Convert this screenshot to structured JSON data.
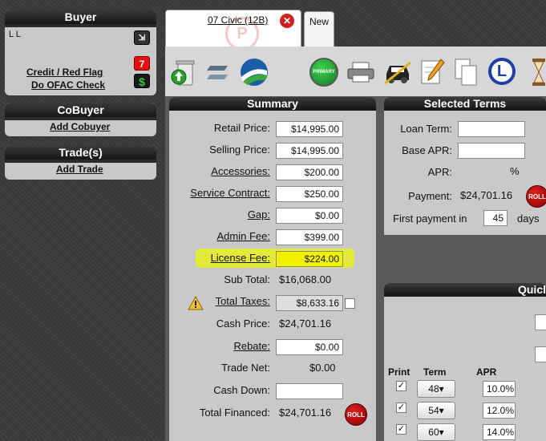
{
  "buyer": {
    "title": "Buyer",
    "name": "L L",
    "credit_link": "Credit / Red Flag",
    "ofac_link": "Do OFAC Check",
    "badge_count": "7",
    "dollar_icon": "$"
  },
  "cobuyer": {
    "title": "CoBuyer",
    "add_link": "Add Cobuyer"
  },
  "trades": {
    "title": "Trade(s)",
    "add_link": "Add Trade"
  },
  "tabs": [
    {
      "label": "07 Civic (12B)"
    },
    {
      "label": "New"
    }
  ],
  "toolbar": {
    "primary_label": "PRIMARY",
    "l_label": "L"
  },
  "summary": {
    "title": "Summary",
    "retail_price_label": "Retail Price:",
    "retail_price": "$14,995.00",
    "selling_price_label": "Selling Price:",
    "selling_price": "$14,995.00",
    "accessories_label": "Accessories:",
    "accessories": "$200.00",
    "service_contract_label": "Service Contract:",
    "service_contract": "$250.00",
    "gap_label": "Gap:",
    "gap": "$0.00",
    "admin_fee_label": "Admin Fee:",
    "admin_fee": "$399.00",
    "license_fee_label": "License Fee:",
    "license_fee": "$224.00",
    "sub_total_label": "Sub Total:",
    "sub_total": "$16,068.00",
    "total_taxes_label": "Total Taxes:",
    "total_taxes": "$8,633.16",
    "cash_price_label": "Cash Price:",
    "cash_price": "$24,701.16",
    "rebate_label": "Rebate:",
    "rebate": "$0.00",
    "trade_net_label": "Trade Net:",
    "trade_net": "$0.00",
    "cash_down_label": "Cash Down:",
    "cash_down": "",
    "total_financed_label": "Total Financed:",
    "total_financed": "$24,701.16",
    "roll_label": "ROLL"
  },
  "selected_terms": {
    "title": "Selected Terms",
    "loan_term_label": "Loan Term:",
    "loan_term": "",
    "base_apr_label": "Base APR:",
    "base_apr": "",
    "apr_label": "APR:",
    "apr_unit": "%",
    "payment_label": "Payment:",
    "payment": "$24,701.16",
    "roll_label": "ROLL",
    "first_payment_label": "First payment in",
    "first_payment_days": "45",
    "days_label": "days"
  },
  "quick": {
    "title": "Quicl",
    "col_print": "Print",
    "col_term": "Term",
    "col_apr": "APR",
    "rows": [
      {
        "term": "48",
        "apr": "10.0%"
      },
      {
        "term": "54",
        "apr": "12.0%"
      },
      {
        "term": "60",
        "apr": "14.0%"
      }
    ]
  },
  "colors": {
    "highlight": "#e8f020",
    "tab_close": "#d02020",
    "primary_btn": "#1c9a2a"
  }
}
